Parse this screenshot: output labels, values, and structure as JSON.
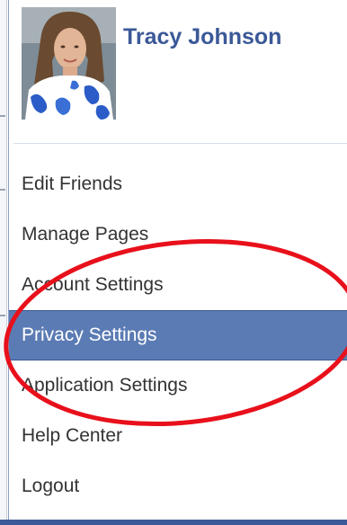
{
  "profile": {
    "name": "Tracy Johnson"
  },
  "menu": {
    "items": [
      {
        "label": "Edit Friends"
      },
      {
        "label": "Manage Pages"
      },
      {
        "label": "Account Settings"
      },
      {
        "label": "Privacy Settings"
      },
      {
        "label": "Application Settings"
      },
      {
        "label": "Help Center"
      },
      {
        "label": "Logout"
      }
    ],
    "highlighted": "Privacy Settings"
  },
  "annotation": {
    "shape": "ellipse",
    "color": "#e8101b",
    "encloses": [
      "Account Settings",
      "Privacy Settings",
      "Application Settings"
    ]
  },
  "colors": {
    "brand": "#3b5998",
    "highlight": "#5b7bb4",
    "text": "#333333"
  }
}
